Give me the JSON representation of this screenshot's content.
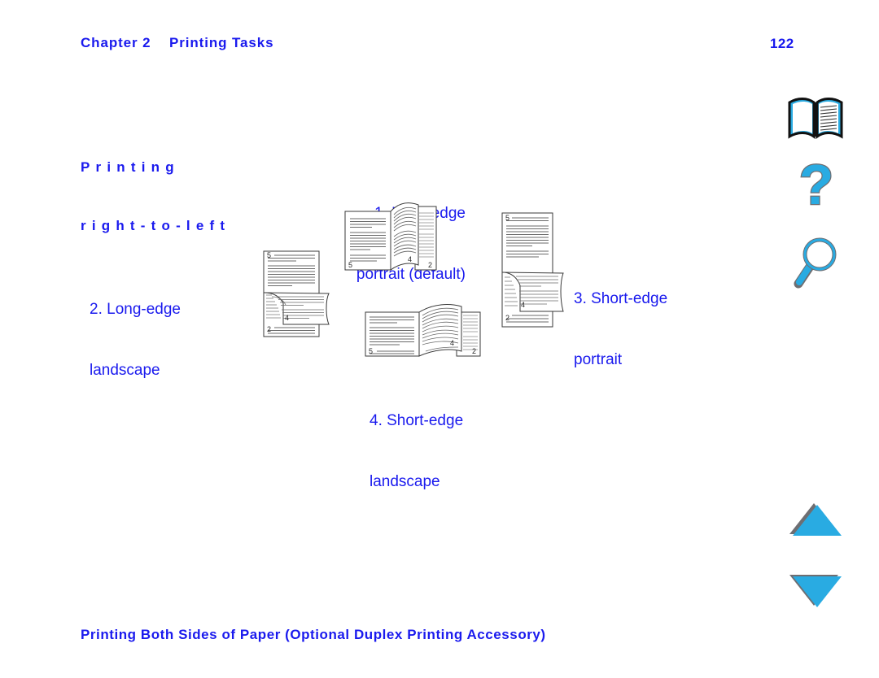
{
  "document": {
    "header": {
      "chapter_label": "Chapter 2    Printing Tasks",
      "page_number": "122"
    },
    "section": {
      "heading_line_1": "Printing",
      "heading_line_2": "right-to-left"
    },
    "footer": {
      "text": "Printing Both Sides of Paper (Optional Duplex Printing Accessory)"
    }
  },
  "diagram": {
    "labels": [
      {
        "id": "1",
        "line1": "1. Long-edge",
        "line2": "portrait (default)"
      },
      {
        "id": "2",
        "line1": "2. Long-edge",
        "line2": "landscape"
      },
      {
        "id": "3",
        "line1": "3. Short-edge",
        "line2": "portrait"
      },
      {
        "id": "4",
        "line1": "4. Short-edge",
        "line2": "landscape"
      }
    ],
    "page_numbers": [
      "5",
      "4",
      "2"
    ]
  },
  "rail": {
    "icons": [
      {
        "name": "book-icon",
        "title": "Contents"
      },
      {
        "name": "question-icon",
        "title": "Help"
      },
      {
        "name": "magnifier-icon",
        "title": "Search"
      },
      {
        "name": "triangle-up-icon",
        "title": "Previous page"
      },
      {
        "name": "triangle-down-icon",
        "title": "Next page"
      }
    ]
  },
  "colors": {
    "text_blue": "#1a1aee",
    "icon_cyan": "#29ABE2",
    "icon_shadow": "#6e6e72",
    "line_gray": "#555555"
  }
}
